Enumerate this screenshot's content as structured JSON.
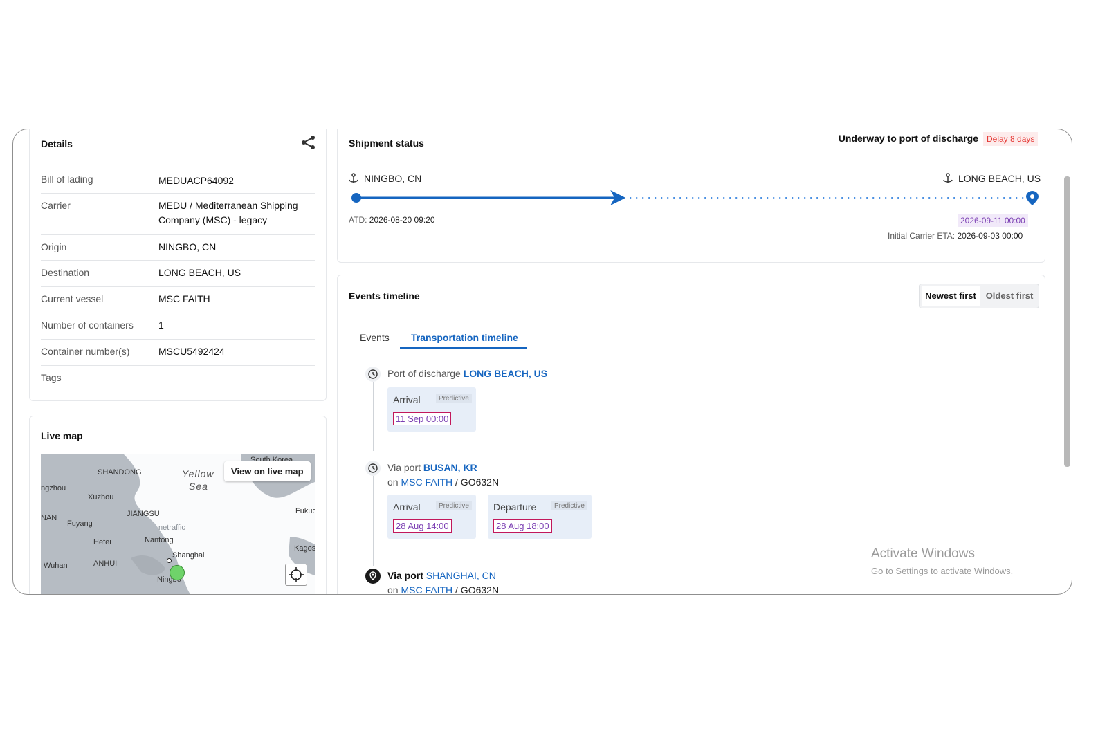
{
  "details": {
    "title": "Details",
    "rows": [
      {
        "label": "Bill of lading",
        "value": "MEDUACP64092"
      },
      {
        "label": "Carrier",
        "value": "MEDU / Mediterranean Shipping Company (MSC) - legacy"
      },
      {
        "label": "Origin",
        "value": "NINGBO, CN"
      },
      {
        "label": "Destination",
        "value": "LONG BEACH, US"
      },
      {
        "label": "Current vessel",
        "value": "MSC FAITH"
      },
      {
        "label": "Number of containers",
        "value": "1"
      },
      {
        "label": "Container number(s)",
        "value": "MSCU5492424"
      },
      {
        "label": "Tags",
        "value": ""
      }
    ]
  },
  "live_map": {
    "title": "Live map",
    "button": "View on live map",
    "labels": {
      "shandong": "SHANDONG",
      "yellow": "Yellow",
      "sea": "Sea",
      "south_korea": "South Korea",
      "gzhou": "ngzhou",
      "xuzhou": "Xuzhou",
      "jiangsu": "JIANGSU",
      "nan": "NAN",
      "fuyang": "Fuyang",
      "hefei": "Hefei",
      "nantong": "Nantong",
      "shanghai": "Shanghai",
      "wuhan": "Wuhan",
      "anhui": "ANHUI",
      "ningbo": "Ningbo",
      "fukuo": "Fukuo",
      "kago": "Kagos",
      "watermark": "netraffic"
    }
  },
  "shipment": {
    "title": "Shipment status",
    "status": "Underway to port of discharge",
    "delay": "Delay 8 days",
    "origin": "NINGBO, CN",
    "destination": "LONG BEACH, US",
    "atd_label": "ATD:",
    "atd": "2026-08-20 09:20",
    "eta": "2026-09-11 00:00",
    "initial_label": "Initial Carrier ETA:",
    "initial_eta": "2026-09-03 00:00",
    "progress": 0.4
  },
  "events": {
    "title": "Events timeline",
    "sort": {
      "newest": "Newest first",
      "oldest": "Oldest first",
      "selected": "Newest first"
    },
    "tabs": {
      "events": "Events",
      "transport": "Transportation timeline",
      "selected": "Transportation timeline"
    },
    "items": [
      {
        "prefix": "Port of discharge",
        "port": "LONG BEACH, US",
        "boxes": [
          {
            "name": "Arrival",
            "tag": "Predictive",
            "date": "11 Sep 00:00"
          }
        ]
      },
      {
        "prefix": "Via port",
        "port": "BUSAN, KR",
        "on": "on",
        "vessel": "MSC FAITH",
        "voyage": "/ GO632N",
        "boxes": [
          {
            "name": "Arrival",
            "tag": "Predictive",
            "date": "28 Aug 14:00"
          },
          {
            "name": "Departure",
            "tag": "Predictive",
            "date": "28 Aug 18:00"
          }
        ]
      },
      {
        "prefix": "Via port",
        "port": "SHANGHAI, CN",
        "on": "on",
        "vessel": "MSC FAITH",
        "voyage": "/ GO632N"
      }
    ]
  },
  "os_watermark": {
    "title": "Activate Windows",
    "subtitle": "Go to Settings to activate Windows."
  }
}
